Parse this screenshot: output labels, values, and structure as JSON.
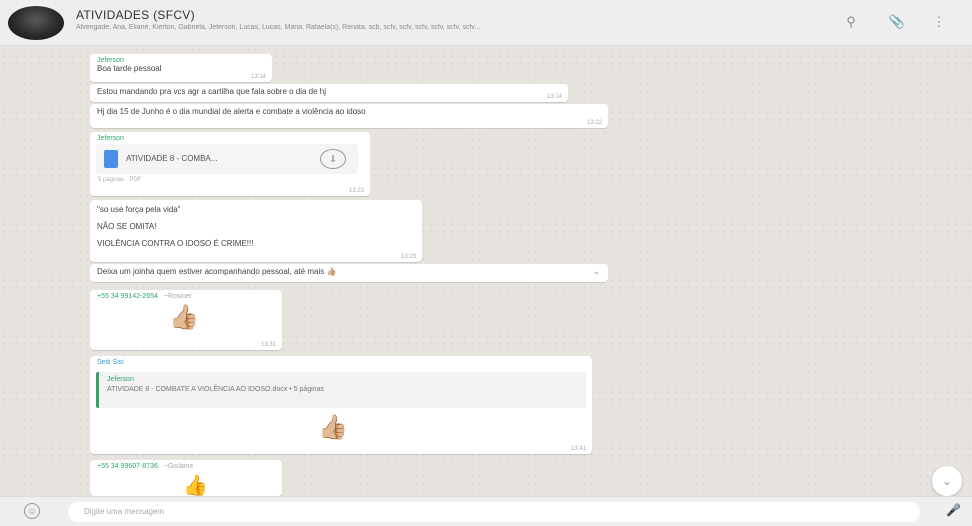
{
  "header": {
    "title": "ATIVIDADES (SFCV)",
    "members": "Alvengade, Ana, Eliane, Kierton, Gabriela, Jeferson, Lucas, Lucas, Maria, Rafaela(s), Renata, scb, scfv, scfv, scfv, scfv, scfv, scfv..."
  },
  "messages": {
    "m1": {
      "sender": "Jeferson",
      "text": "Boa tarde pessoal",
      "time": "13:14"
    },
    "m2": {
      "text": "Estou mandando pra vcs agr a cartilha que fala sobre o dia de hj",
      "time": "13:14"
    },
    "m3": {
      "text": "Hj dia 15 de Junho é o dia mundial de alerta e combate a violência ao idoso",
      "time": "13:22"
    },
    "m4": {
      "sender": "Jeferson",
      "doc_name": "ATIVIDADE 8 - COMBA...",
      "doc_meta": "5 páginas · PDF",
      "time": "13:23"
    },
    "m5": {
      "line1": "\"so use força pela vida\"",
      "line2": "NÃO SE OMITA!",
      "line3": "VIOLÊNCIA CONTRA O IDOSO É CRIME!!!",
      "time": "13:23"
    },
    "m6": {
      "text": "Deixa um joinha quem estiver acompanhando pessoal, até mais 👍🏼"
    },
    "m7": {
      "sender": "+55 34 99142-2654",
      "sender_note": "~Rosinei",
      "emoji": "👍🏼",
      "time": "13:31"
    },
    "m8": {
      "sender": "Seiti Sisi",
      "quoted_sender": "Jeferson",
      "quoted_text": "ATIVIDADE 8 - COMBATE A VIOLÊNCIA AO IDOSO.docx • 5 páginas",
      "emoji": "👍🏼",
      "time": "13:41"
    },
    "m9": {
      "sender": "+55 34 99607-8736",
      "sender_note": "~Gislaine",
      "emoji": "👍"
    }
  },
  "footer": {
    "placeholder": "Digite uma mensagem"
  },
  "icons": {
    "search": "search-icon",
    "attach": "paperclip-icon",
    "menu": "menu-icon",
    "emoji": "emoji-icon",
    "mic": "mic-icon"
  }
}
